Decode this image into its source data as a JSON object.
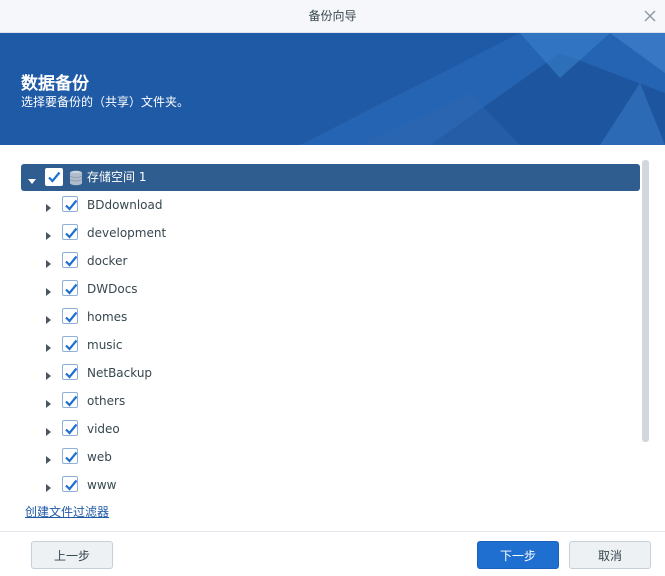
{
  "window": {
    "title": "备份向导"
  },
  "banner": {
    "heading": "数据备份",
    "subtitle": "选择要备份的（共享）文件夹。"
  },
  "tree": {
    "root": {
      "label": "存储空间 1",
      "checked": true,
      "expanded": true
    },
    "folders": [
      {
        "label": "BDdownload",
        "checked": true
      },
      {
        "label": "development",
        "checked": true
      },
      {
        "label": "docker",
        "checked": true
      },
      {
        "label": "DWDocs",
        "checked": true
      },
      {
        "label": "homes",
        "checked": true
      },
      {
        "label": "music",
        "checked": true
      },
      {
        "label": "NetBackup",
        "checked": true
      },
      {
        "label": "others",
        "checked": true
      },
      {
        "label": "video",
        "checked": true
      },
      {
        "label": "web",
        "checked": true
      },
      {
        "label": "www",
        "checked": true
      }
    ]
  },
  "links": {
    "create_filter": "创建文件过滤器"
  },
  "footer": {
    "prev": "上一步",
    "next": "下一步",
    "cancel": "取消"
  },
  "colors": {
    "banner": "#1f5aa6",
    "selected_row": "#2f5d8f",
    "checkmark": "#1f6fd0",
    "primary_button": "#1f6fd0"
  }
}
